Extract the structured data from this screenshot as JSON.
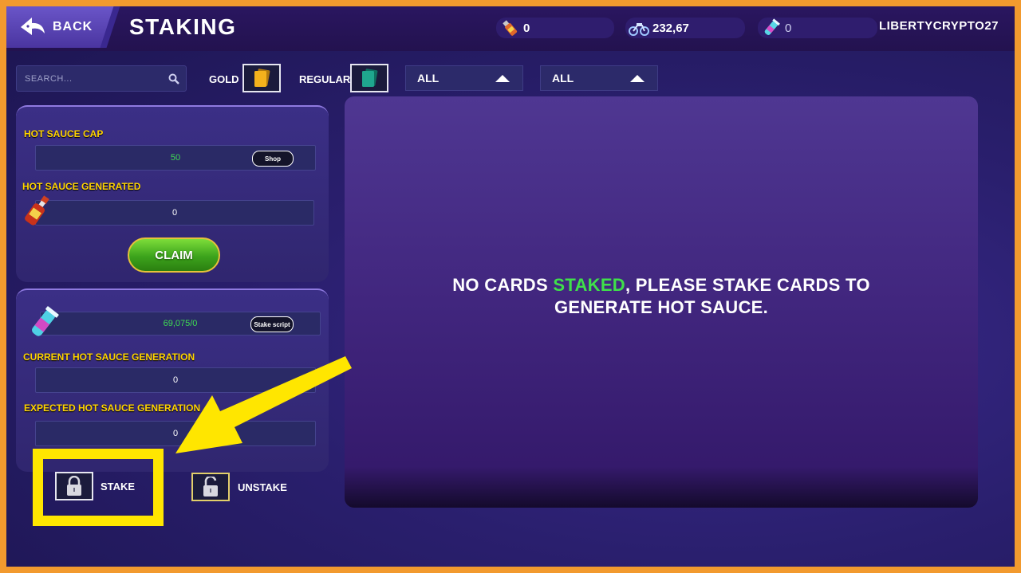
{
  "header": {
    "back_label": "BACK",
    "title": "STAKING",
    "resources": [
      {
        "icon": "hot-sauce-bottle-icon",
        "value": "0"
      },
      {
        "icon": "motorbike-icon",
        "value": "232,67"
      },
      {
        "icon": "script-vial-icon",
        "value": "0"
      }
    ],
    "username": "LIBERTYCRYPTO27"
  },
  "filters": {
    "search_placeholder": "SEARCH...",
    "gold_label": "GOLD",
    "regular_label": "REGULAR",
    "dropdown1": "ALL",
    "dropdown2": "ALL"
  },
  "sauce_panel": {
    "cap_label": "HOT SAUCE CAP",
    "cap_value": "50",
    "shop_label": "Shop",
    "generated_label": "HOT SAUCE GENERATED",
    "generated_value": "0",
    "claim_label": "CLAIM"
  },
  "script_panel": {
    "script_value": "69,075/0",
    "stake_script_label": "Stake script",
    "current_label": "CURRENT HOT SAUCE GENERATION",
    "current_value": "0",
    "expected_label": "EXPECTED HOT SAUCE GENERATION",
    "expected_value": "0"
  },
  "actions": {
    "stake_label": "STAKE",
    "unstake_label": "UNSTAKE"
  },
  "main": {
    "message_before": "NO CARDS ",
    "message_highlight": "STAKED",
    "message_line1_after": ", PLEASE STAKE CARDS TO",
    "message_line2": "GENERATE HOT SAUCE."
  },
  "colors": {
    "accent_green": "#3fe04a",
    "label_yellow": "#ffd400",
    "highlight_yellow": "#ffe600",
    "frame_orange": "#f29a2e"
  }
}
